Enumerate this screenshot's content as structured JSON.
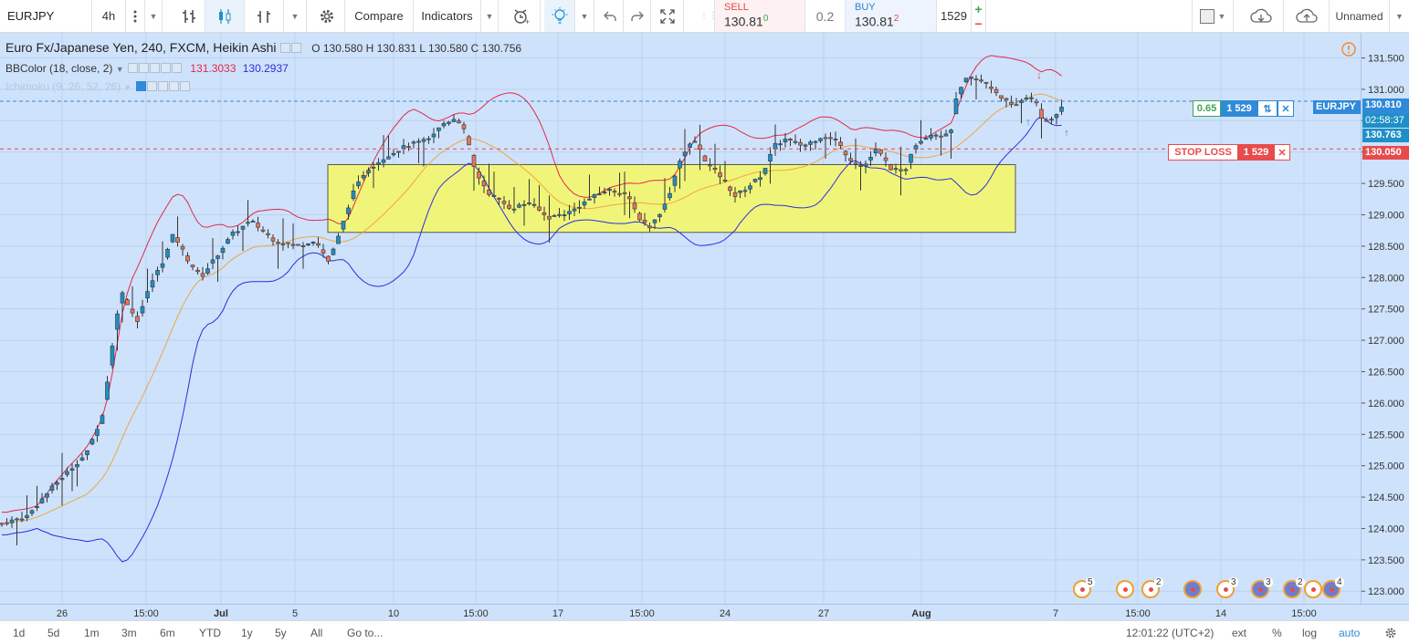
{
  "toolbar": {
    "symbol": "EURJPY",
    "interval": "4h",
    "compare_label": "Compare",
    "indicators_label": "Indicators",
    "sell_label": "SELL",
    "sell_price": "130.81",
    "sell_sup": "0",
    "spread": "0.2",
    "buy_label": "BUY",
    "buy_price": "130.81",
    "buy_sup": "2",
    "quantity": "1529",
    "plus": "+",
    "minus": "−",
    "layout_name": "Unnamed"
  },
  "legend": {
    "title": "Euro Fx/Japanese Yen, 240, FXCM, Heikin Ashi",
    "o_label": "O",
    "o": "130.580",
    "h_label": "H",
    "h": "130.831",
    "l_label": "L",
    "l": "130.580",
    "c_label": "C",
    "c": "130.756",
    "bb_name": "BBColor (18, close, 2)",
    "bb_upper": "131.3033",
    "bb_lower": "130.2937",
    "ichimoku_name": "Ichimoku (9, 26, 52, 26)"
  },
  "price_scale": {
    "labels": [
      "131.500",
      "131.000",
      "130.500",
      "130.000",
      "129.500",
      "129.000",
      "128.500",
      "128.000",
      "127.500",
      "127.000",
      "126.500",
      "126.000",
      "125.500",
      "125.000",
      "124.500",
      "124.000",
      "123.500",
      "123.000"
    ],
    "tag_symbol": "EURJPY",
    "tag_bid": "130.810",
    "tag_countdown": "02:58:37",
    "tag_close": "130.763",
    "tag_stop": "130.050"
  },
  "time_scale": {
    "labels": [
      "26",
      "15:00",
      "Jul",
      "5",
      "10",
      "15:00",
      "17",
      "15:00",
      "24",
      "27",
      "Aug",
      "7",
      "15:00",
      "14",
      "15:00"
    ]
  },
  "position": {
    "pnl": "0.65",
    "qty": "1 529"
  },
  "stop_loss": {
    "label": "STOP LOSS",
    "qty": "1 529"
  },
  "events": {
    "counts": [
      "5",
      "2",
      "3",
      "3",
      "2",
      "4"
    ]
  },
  "bottom": {
    "ranges": [
      "1d",
      "5d",
      "1m",
      "3m",
      "6m",
      "YTD",
      "1y",
      "5y",
      "All"
    ],
    "goto": "Go to...",
    "clock": "12:01:22 (UTC+2)",
    "ext": "ext",
    "percent": "%",
    "log": "log",
    "auto": "auto"
  },
  "colors": {
    "up": "#1f8fc7",
    "down": "#e5775f",
    "bb_upper": "#e0294a",
    "bb_lower": "#2a2ee0",
    "highlight": "#f0f57a",
    "stop": "#e84b4b",
    "bid_tag": "#2f8ad8"
  },
  "chart_data": {
    "type": "candlestick",
    "series_type": "Heikin Ashi",
    "ylim": [
      122.8,
      131.9
    ],
    "highlight_zone": {
      "y_top": 129.8,
      "y_bottom": 128.72
    },
    "current_price": 130.81,
    "stop_loss_price": 130.05,
    "candles": []
  }
}
